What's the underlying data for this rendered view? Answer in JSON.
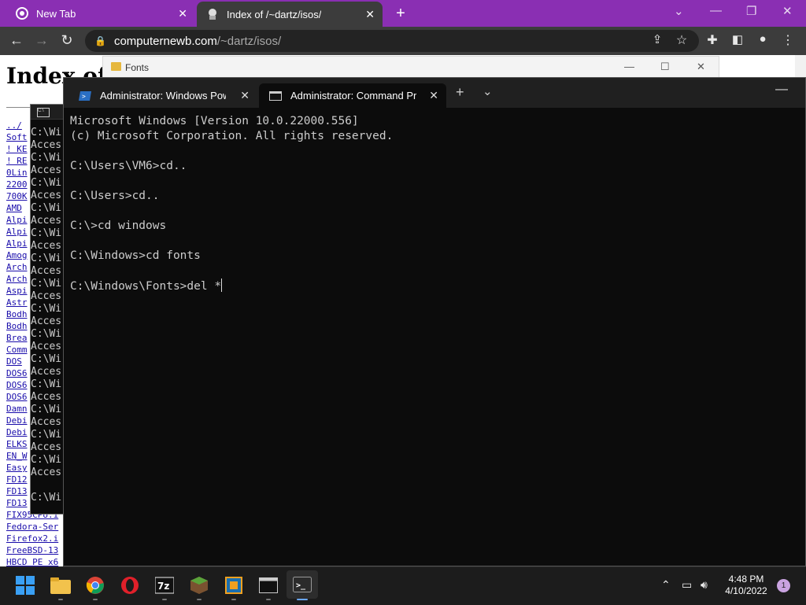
{
  "browser": {
    "tabs": [
      {
        "title": "New Tab",
        "icon": "chrome-icon"
      },
      {
        "title": "Index of /~dartz/isos/",
        "icon": "site-icon"
      }
    ],
    "url_host": "computernewb.com",
    "url_path": "/~dartz/isos/",
    "accent": "#8a2fb3"
  },
  "webpage": {
    "title": "Index of",
    "links": [
      "../",
      "Soft",
      "! KE",
      "! RE",
      "0Lin",
      "2200",
      "700K",
      "AMD",
      "Alpi",
      "Alpi",
      "Alpi",
      "Amog",
      "Arch",
      "Arch",
      "Aspi",
      "Astr",
      "Bodh",
      "Bodh",
      "Brea",
      "Comm",
      "DOS",
      "DOS6",
      "DOS6",
      "DOS6",
      "Damn",
      "Debi",
      "Debi",
      "ELKS",
      "EN_W",
      "Easy",
      "FD12",
      "FD13",
      "FD13",
      "FIX95CPU.i",
      "Fedora-Ser",
      "Firefox2.i",
      "FreeBSD-13",
      "HBCD_PE_x6"
    ]
  },
  "explorer": {
    "title": "Fonts"
  },
  "back_cmd": {
    "lines": [
      "C:\\Wi",
      "Acces",
      "C:\\Wi",
      "Acces",
      "C:\\Wi",
      "Acces",
      "C:\\Wi",
      "Acces",
      "C:\\Wi",
      "Acces",
      "C:\\Wi",
      "Acces",
      "C:\\Wi",
      "Acces",
      "C:\\Wi",
      "Acces",
      "C:\\Wi",
      "Acces",
      "C:\\Wi",
      "Acces",
      "C:\\Wi",
      "Acces",
      "C:\\Wi",
      "Acces",
      "C:\\Wi",
      "Acces",
      "C:\\Wi",
      "Acces",
      "",
      "C:\\Wi"
    ]
  },
  "terminal": {
    "tabs": [
      {
        "title": "Administrator: Windows PowerS",
        "icon": "powershell-icon"
      },
      {
        "title": "Administrator: Command Promp",
        "icon": "cmd-icon"
      }
    ],
    "lines": [
      "Microsoft Windows [Version 10.0.22000.556]",
      "(c) Microsoft Corporation. All rights reserved.",
      "",
      "C:\\Users\\VM6>cd..",
      "",
      "C:\\Users>cd..",
      "",
      "C:\\>cd windows",
      "",
      "C:\\Windows>cd fonts",
      "",
      "C:\\Windows\\Fonts>del *"
    ]
  },
  "taskbar": {
    "apps": [
      "start",
      "file-explorer",
      "chrome",
      "opera",
      "7zip",
      "minecraft",
      "virtualbox",
      "command-prompt",
      "terminal"
    ],
    "time": "4:48 PM",
    "date": "4/10/2022",
    "notification_count": "1"
  }
}
